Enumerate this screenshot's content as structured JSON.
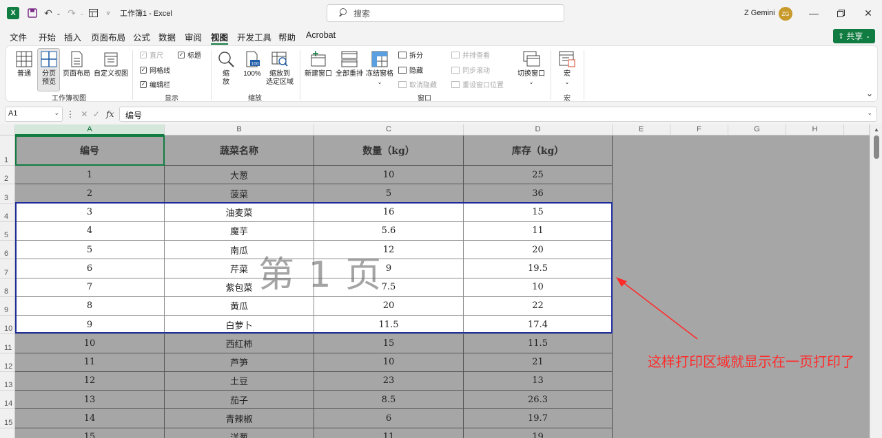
{
  "titlebar": {
    "app_icon_letter": "X",
    "title": "工作簿1 - Excel",
    "search_placeholder": "搜索",
    "user_name": "Z Gemini",
    "user_initials": "ZG"
  },
  "menu_tabs": [
    "文件",
    "开始",
    "插入",
    "页面布局",
    "公式",
    "数据",
    "审阅",
    "视图",
    "开发工具",
    "帮助",
    "Acrobat"
  ],
  "active_tab": "视图",
  "share_label": "共享",
  "ribbon": {
    "workbook_views": {
      "normal": "普通",
      "page_break_line1": "分页",
      "page_break_line2": "预览",
      "page_layout": "页面布局",
      "custom_view": "自定义视图",
      "group_label": "工作簿视图"
    },
    "show": {
      "ruler": "直尺",
      "headings": "标题",
      "gridlines": "网格线",
      "formula_bar": "编辑栏",
      "group_label": "显示"
    },
    "zoom": {
      "zoom_line1": "缩",
      "zoom_line2": "放",
      "hundred": "100%",
      "zoom_sel_line1": "缩放到",
      "zoom_sel_line2": "选定区域",
      "group_label": "缩放"
    },
    "window": {
      "new_window": "新建窗口",
      "arrange_all": "全部重排",
      "freeze_panes": "冻结窗格",
      "split": "拆分",
      "hide": "隐藏",
      "unhide": "取消隐藏",
      "side_by_side": "并排查看",
      "sync_scroll": "同步滚动",
      "reset_position": "重设窗口位置",
      "switch_windows": "切换窗口",
      "group_label": "窗口"
    },
    "macros": {
      "label": "宏",
      "group_label": "宏"
    }
  },
  "formula_bar": {
    "name_box": "A1",
    "content": "编号"
  },
  "columns": [
    "A",
    "B",
    "C",
    "D",
    "E",
    "F",
    "G",
    "H"
  ],
  "table": {
    "headers": [
      "编号",
      "蔬菜名称",
      "数量（kg）",
      "库存（kg）"
    ],
    "rows": [
      [
        "1",
        "大葱",
        "10",
        "25"
      ],
      [
        "2",
        "菠菜",
        "5",
        "36"
      ],
      [
        "3",
        "油麦菜",
        "16",
        "15"
      ],
      [
        "4",
        "魔芋",
        "5.6",
        "11"
      ],
      [
        "5",
        "南瓜",
        "12",
        "20"
      ],
      [
        "6",
        "芹菜",
        "9",
        "19.5"
      ],
      [
        "7",
        "紫包菜",
        "7.5",
        "10"
      ],
      [
        "8",
        "黄瓜",
        "20",
        "22"
      ],
      [
        "9",
        "白萝卜",
        "11.5",
        "17.4"
      ],
      [
        "10",
        "西红柿",
        "15",
        "11.5"
      ],
      [
        "11",
        "芦笋",
        "10",
        "21"
      ],
      [
        "12",
        "土豆",
        "23",
        "13"
      ],
      [
        "13",
        "茄子",
        "8.5",
        "26.3"
      ],
      [
        "14",
        "青辣椒",
        "6",
        "19.7"
      ],
      [
        "15",
        "洋葱",
        "11",
        "19"
      ]
    ]
  },
  "page_watermark": "第 1 页",
  "annotation": "这样打印区域就显示在一页打印了",
  "colors": {
    "excel_green": "#107c41",
    "print_area_border": "#1f2d9c",
    "annotation_red": "#ff2b2b"
  }
}
